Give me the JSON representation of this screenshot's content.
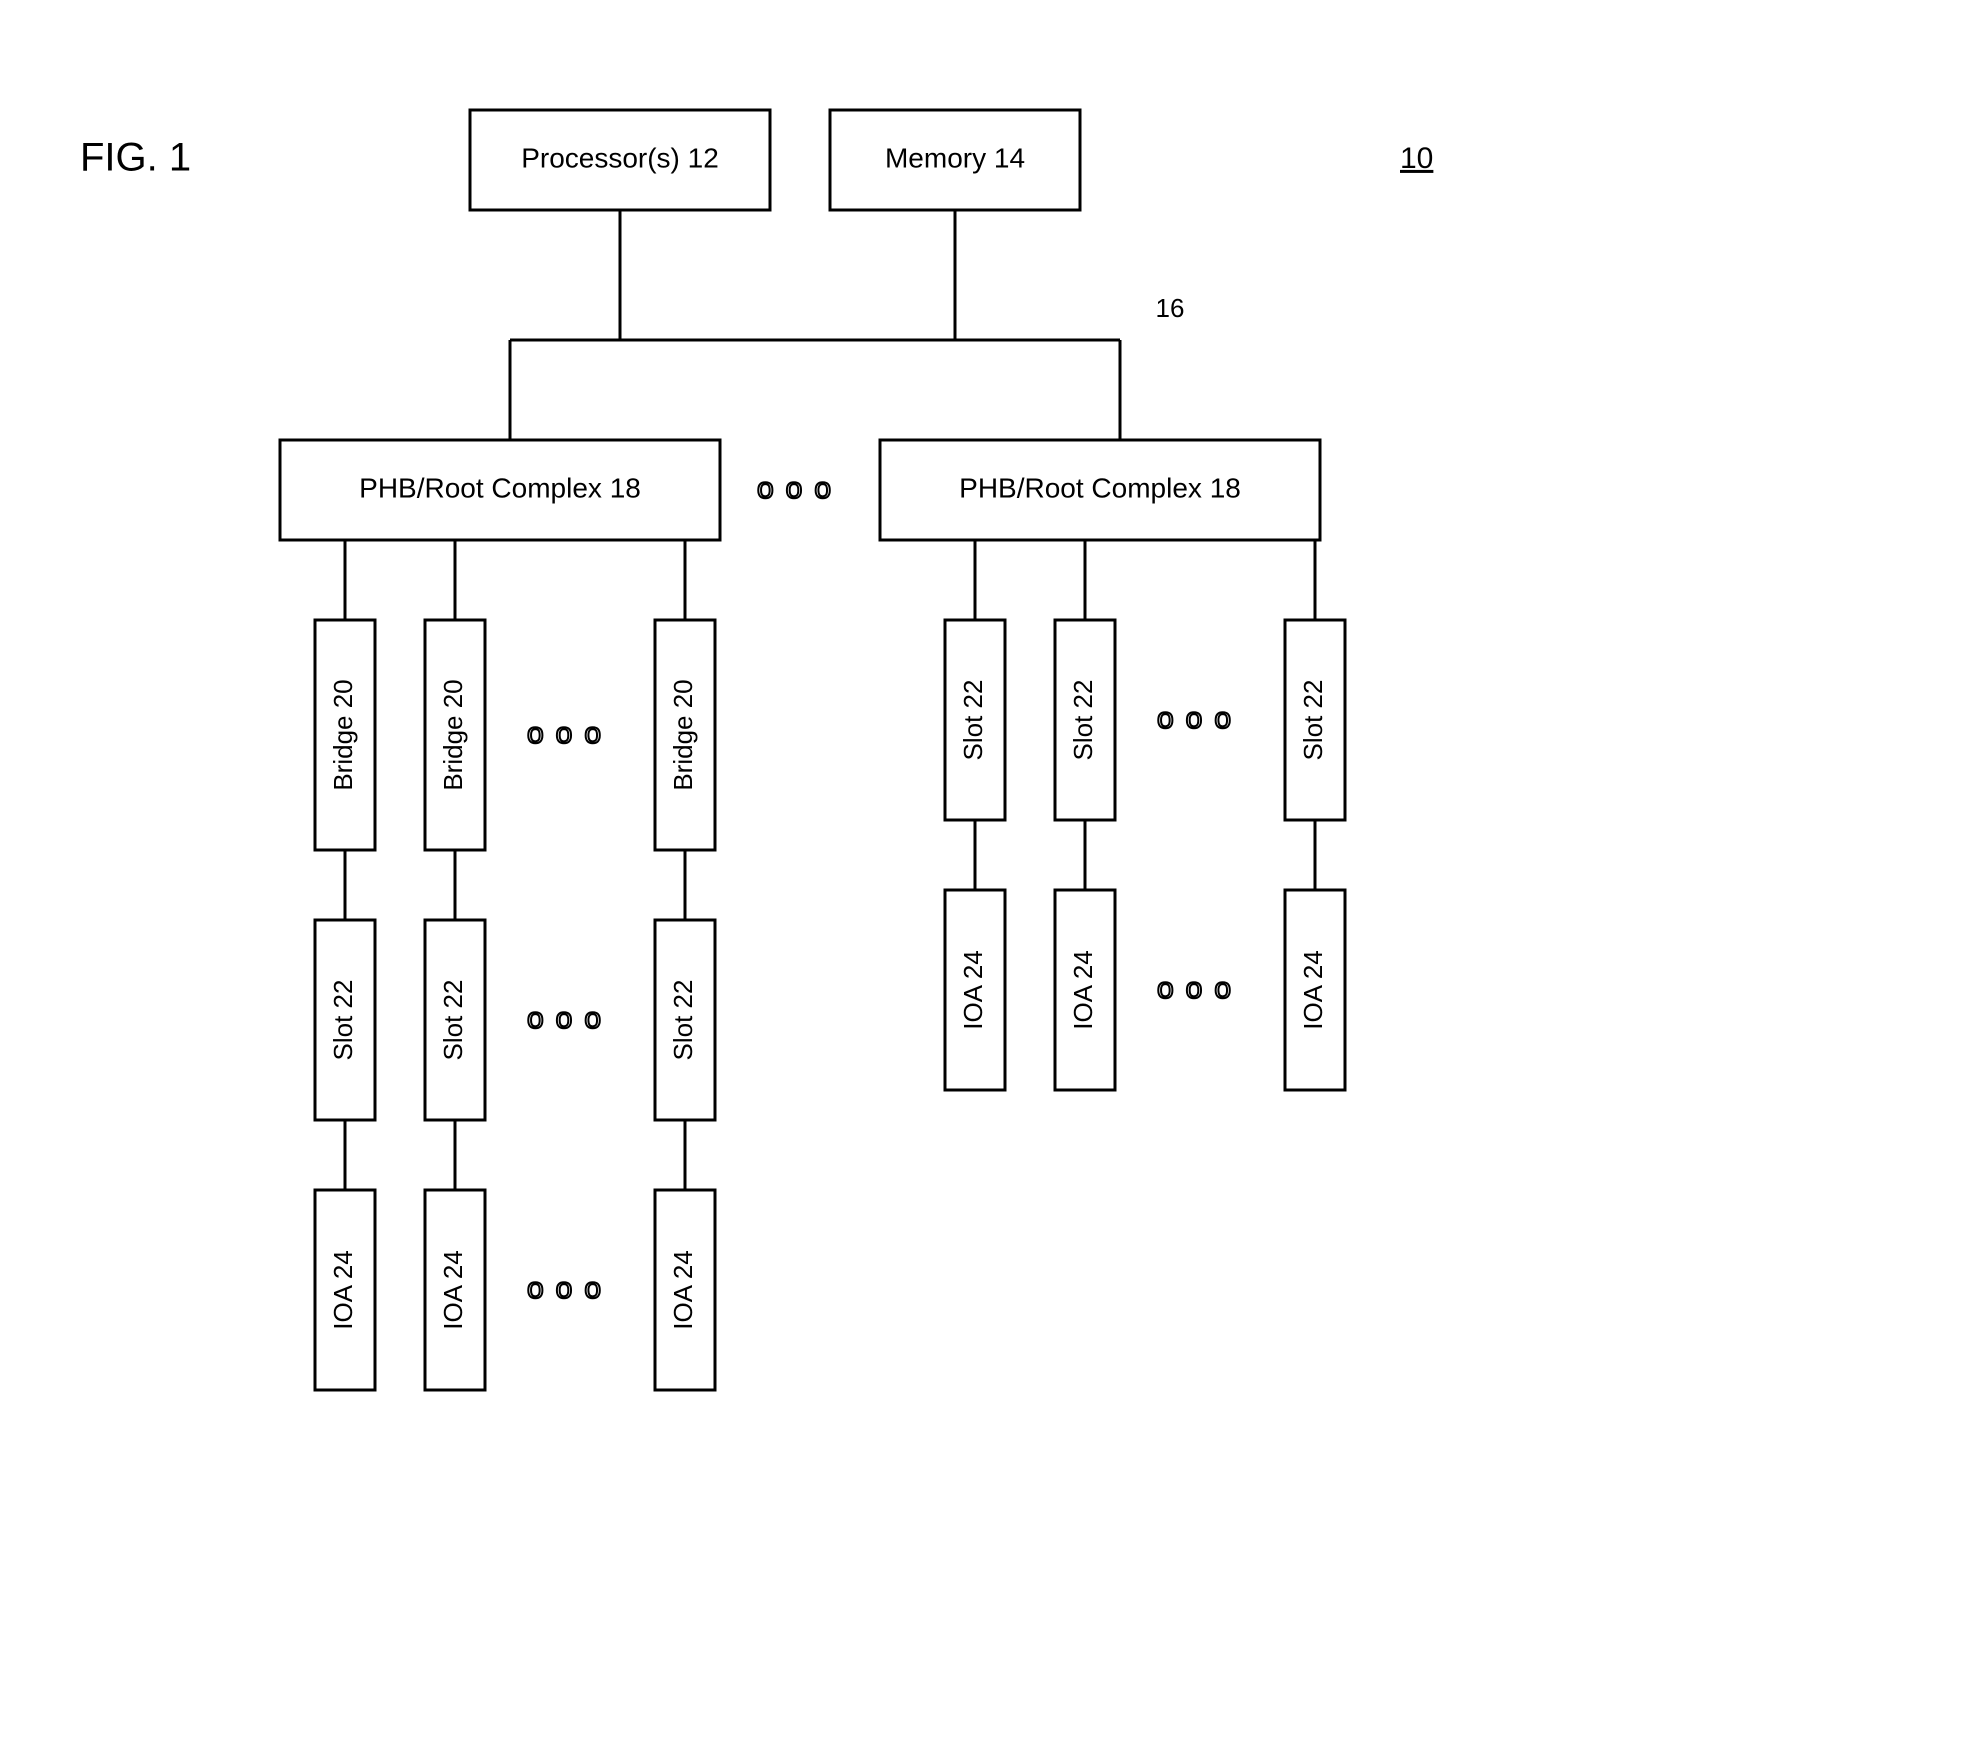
{
  "figure": {
    "label": "FIG. 1",
    "ref": "10",
    "bus_ref": "16"
  },
  "top": {
    "proc": "Processor(s) 12",
    "mem": "Memory 14"
  },
  "phb": {
    "left": "PHB/Root Complex 18",
    "right": "PHB/Root Complex 18"
  },
  "bridge": {
    "b1": "Bridge 20",
    "b2": "Bridge 20",
    "b3": "Bridge 20"
  },
  "slotL": {
    "s1": "Slot 22",
    "s2": "Slot 22",
    "s3": "Slot 22"
  },
  "ioaL": {
    "i1": "IOA 24",
    "i2": "IOA 24",
    "i3": "IOA 24"
  },
  "slotR": {
    "s1": "Slot 22",
    "s2": "Slot 22",
    "s3": "Slot 22"
  },
  "ioaR": {
    "i1": "IOA 24",
    "i2": "IOA 24",
    "i3": "IOA 24"
  },
  "ellipsis": "○ ○ ○"
}
